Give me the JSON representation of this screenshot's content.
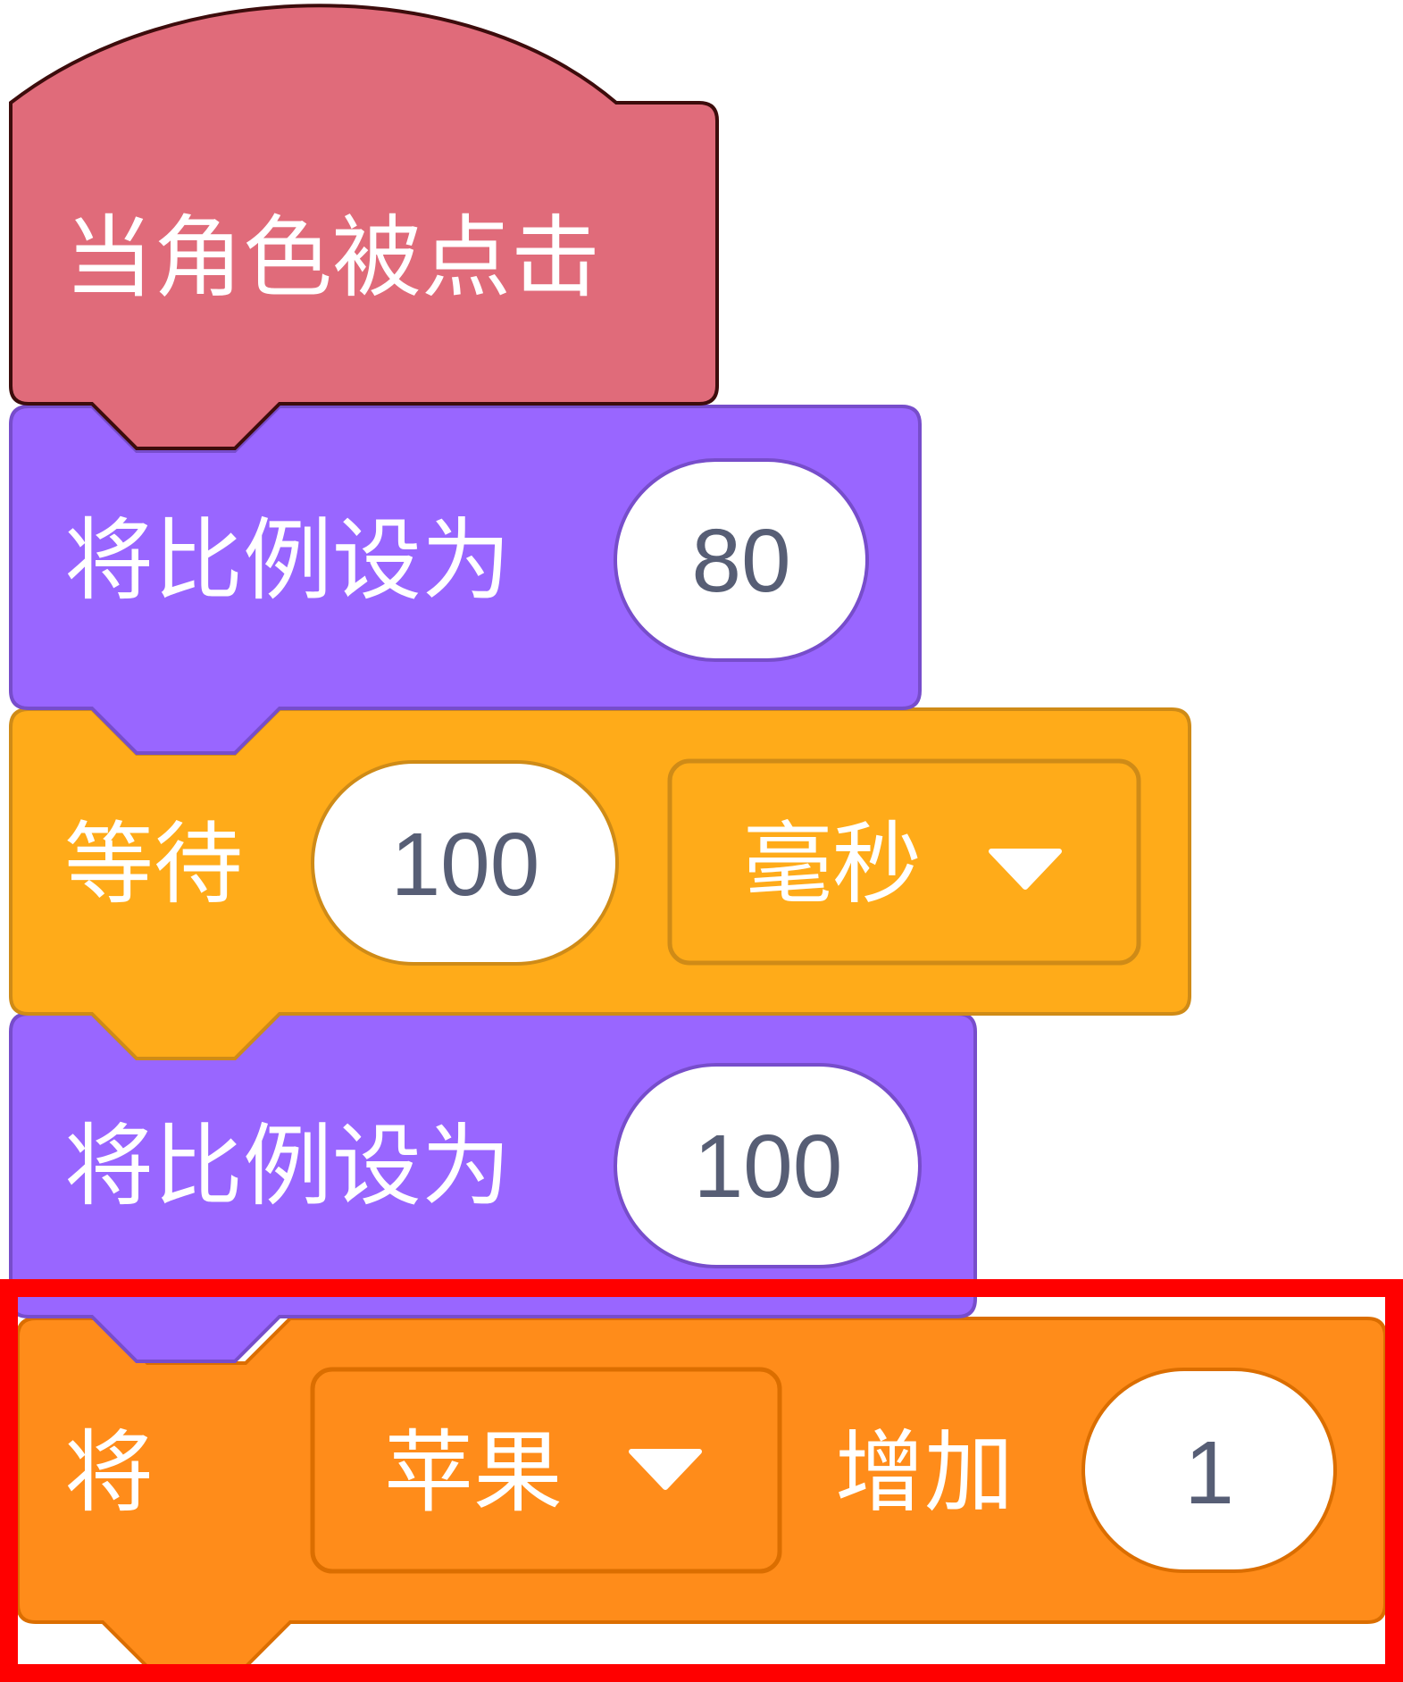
{
  "script": {
    "hat_block": {
      "label": "当角色被点击",
      "color": "#e06b7a"
    },
    "set_size_block_1": {
      "label": "将比例设为",
      "value": "80",
      "color": "#9966ff"
    },
    "wait_block": {
      "label": "等待",
      "value": "100",
      "unit": "毫秒",
      "color": "#ffab19"
    },
    "set_size_block_2": {
      "label": "将比例设为",
      "value": "100",
      "color": "#9966ff"
    },
    "change_variable_block": {
      "label_prefix": "将",
      "variable": "苹果",
      "label_action": "增加",
      "value": "1",
      "color": "#ff8c1a"
    }
  },
  "highlight": {
    "target": "change_variable_block",
    "color": "#ff0000"
  },
  "icons": {
    "dropdown": "dropdown-arrow-icon"
  }
}
